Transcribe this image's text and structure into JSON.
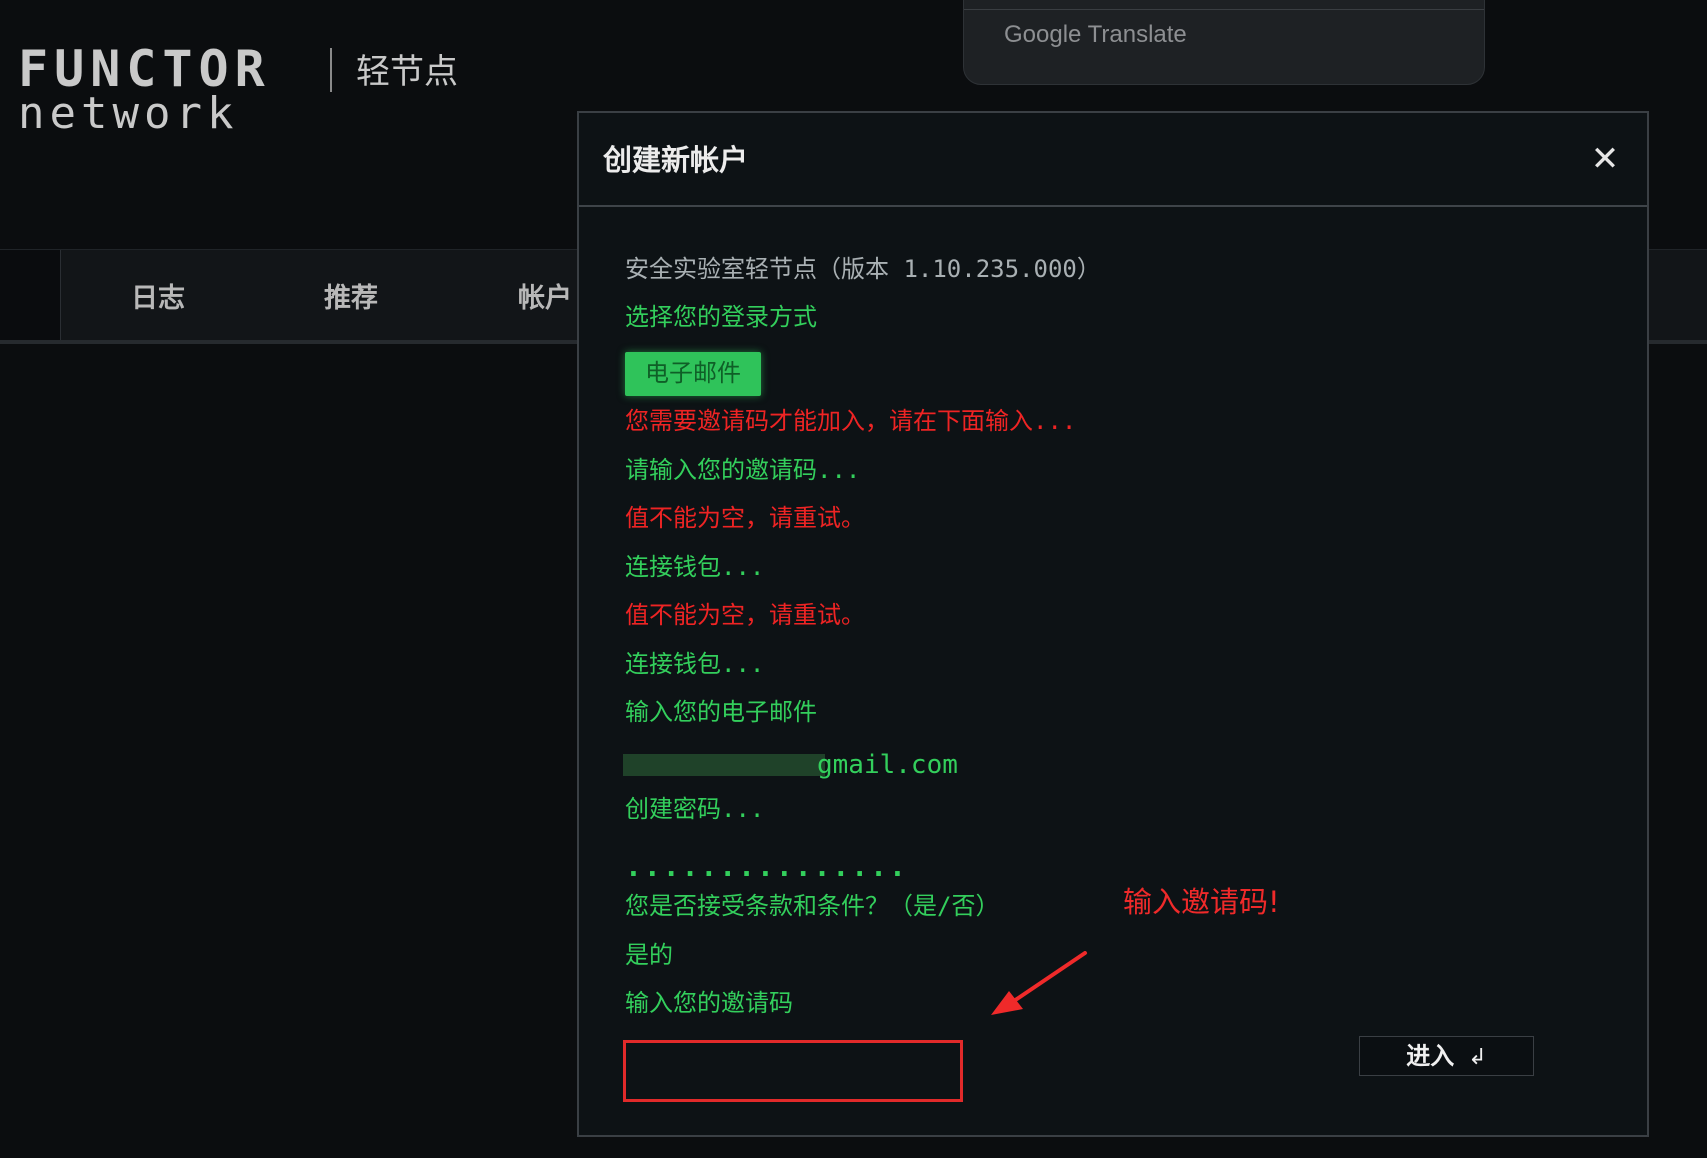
{
  "app": {
    "logo_main": "FUNCTOR",
    "logo_sub": "network",
    "logo_tag": "轻节点"
  },
  "nav": {
    "items": [
      {
        "label": "日志"
      },
      {
        "label": "推荐"
      },
      {
        "label": "帐户"
      }
    ]
  },
  "translate_popup": {
    "brand": "Google Translate"
  },
  "modal": {
    "title": "创建新帐户",
    "close_symbol": "✕",
    "console": [
      {
        "text": "安全实验室轻节点（版本 1.10.235.000）",
        "color": "#a9b0b3"
      },
      {
        "text": "选择您的登录方式",
        "color": "#33cf5c"
      },
      {
        "text": "您需要邀请码才能加入，请在下面输入...",
        "color": "#ee2424"
      },
      {
        "text": "请输入您的邀请码...",
        "color": "#33cf5c"
      },
      {
        "text": "值不能为空，请重试。",
        "color": "#ee2424"
      },
      {
        "text": "连接钱包...",
        "color": "#33cf5c"
      },
      {
        "text": "值不能为空，请重试。",
        "color": "#ee2424"
      },
      {
        "text": "连接钱包...",
        "color": "#33cf5c"
      },
      {
        "text": "输入您的电子邮件",
        "color": "#33cf5c"
      },
      {
        "text": "创建密码...",
        "color": "#33cf5c"
      },
      {
        "text": "您是否接受条款和条件？（是/否）",
        "color": "#33cf5c"
      },
      {
        "text": "是的",
        "color": "#33cf5c"
      },
      {
        "text": "输入您的邀请码",
        "color": "#33cf5c"
      }
    ],
    "login_option": "电子邮件",
    "email_suffix": "gmail.com",
    "password_mask": "...............",
    "invite_input_value": "",
    "enter_button_label": "进入",
    "enter_icon": "↲"
  },
  "annotation": {
    "text": "输入邀请码!",
    "color": "#ef2a2a"
  },
  "colors": {
    "background": "#0b0d0f",
    "console_green": "#33cf5c",
    "console_red": "#ee2424",
    "console_gray": "#a9b0b3",
    "chip_green": "#2fc35a"
  }
}
